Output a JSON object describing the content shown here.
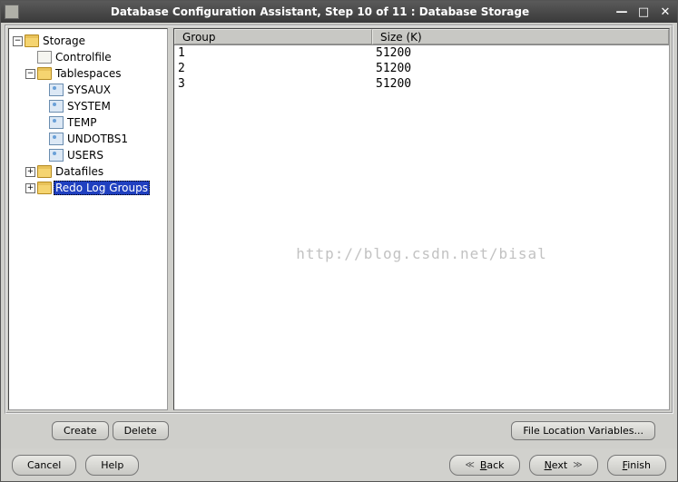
{
  "title": "Database Configuration Assistant, Step 10 of 11 : Database Storage",
  "tree": {
    "root": "Storage",
    "controlfile": "Controlfile",
    "tablespaces": "Tablespaces",
    "ts_items": [
      "SYSAUX",
      "SYSTEM",
      "TEMP",
      "UNDOTBS1",
      "USERS"
    ],
    "datafiles": "Datafiles",
    "redo": "Redo Log Groups"
  },
  "table": {
    "col_group": "Group",
    "col_size": "Size (K)",
    "rows": [
      {
        "group": "1",
        "size": "51200"
      },
      {
        "group": "2",
        "size": "51200"
      },
      {
        "group": "3",
        "size": "51200"
      }
    ]
  },
  "buttons": {
    "create": "Create",
    "delete": "Delete",
    "file_loc": "File Location Variables...",
    "cancel": "Cancel",
    "help": "Help",
    "back": "Back",
    "next": "Next",
    "finish": "Finish"
  },
  "watermark": "http://blog.csdn.net/bisal"
}
